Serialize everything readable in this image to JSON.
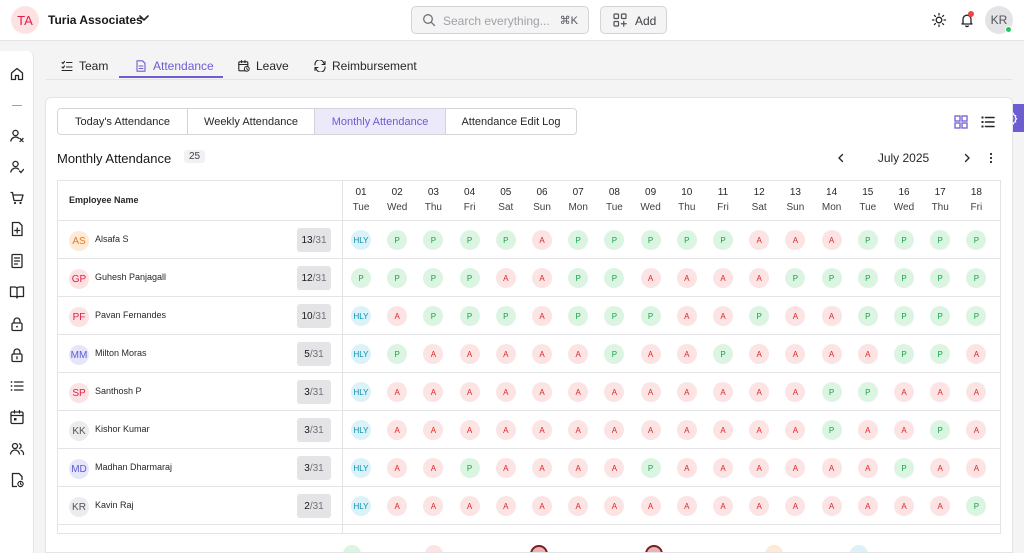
{
  "header": {
    "org_initials": "TA",
    "org_name": "Turia Associates",
    "search_placeholder": "Search everything...",
    "search_shortcut": "⌘K",
    "add_label": "Add",
    "user_initials": "KR"
  },
  "sidebar": {
    "icons": [
      "home-icon",
      "user-x-icon",
      "user-check-icon",
      "cart-icon",
      "file-plus-icon",
      "receipt-icon",
      "book-open-icon",
      "lock-icon",
      "lock-open-icon",
      "list-icon",
      "calendar-icon",
      "users-icon",
      "file-clock-icon"
    ]
  },
  "main_tabs": [
    {
      "label": "Team",
      "icon": "list-checks-icon",
      "active": false
    },
    {
      "label": "Attendance",
      "icon": "file-text-icon",
      "active": true
    },
    {
      "label": "Leave",
      "icon": "calendar-clock-icon",
      "active": false
    },
    {
      "label": "Reimbursement",
      "icon": "refresh-icon",
      "active": false
    }
  ],
  "sub_tabs": [
    {
      "label": "Today's Attendance",
      "active": false
    },
    {
      "label": "Weekly Attendance",
      "active": false
    },
    {
      "label": "Monthly Attendance",
      "active": true
    },
    {
      "label": "Attendance Edit Log",
      "active": false
    }
  ],
  "section": {
    "title": "Monthly Attendance",
    "count": "25",
    "month": "July 2025"
  },
  "table": {
    "name_header": "Employee Name",
    "days": [
      {
        "num": "01",
        "dow": "Tue"
      },
      {
        "num": "02",
        "dow": "Wed"
      },
      {
        "num": "03",
        "dow": "Thu"
      },
      {
        "num": "04",
        "dow": "Fri"
      },
      {
        "num": "05",
        "dow": "Sat"
      },
      {
        "num": "06",
        "dow": "Sun"
      },
      {
        "num": "07",
        "dow": "Mon"
      },
      {
        "num": "08",
        "dow": "Tue"
      },
      {
        "num": "09",
        "dow": "Wed"
      },
      {
        "num": "10",
        "dow": "Thu"
      },
      {
        "num": "11",
        "dow": "Fri"
      },
      {
        "num": "12",
        "dow": "Sat"
      },
      {
        "num": "13",
        "dow": "Sun"
      },
      {
        "num": "14",
        "dow": "Mon"
      },
      {
        "num": "15",
        "dow": "Tue"
      },
      {
        "num": "16",
        "dow": "Wed"
      },
      {
        "num": "17",
        "dow": "Thu"
      },
      {
        "num": "18",
        "dow": "Fri"
      }
    ],
    "rows": [
      {
        "initials": "AS",
        "name": "Alsafa S",
        "present": "13",
        "total": "/31",
        "avatar_bg": "#feead6",
        "avatar_fg": "#ea7a1e",
        "statuses": [
          "HLY",
          "P",
          "P",
          "P",
          "P",
          "A",
          "P",
          "P",
          "P",
          "P",
          "P",
          "A",
          "A",
          "A",
          "P",
          "P",
          "P",
          "P"
        ]
      },
      {
        "initials": "GP",
        "name": "Guhesh Panjagall",
        "present": "12",
        "total": "/31",
        "avatar_bg": "#fde2e4",
        "avatar_fg": "#e11d48",
        "statuses": [
          "P",
          "P",
          "P",
          "P",
          "A",
          "A",
          "P",
          "P",
          "A",
          "A",
          "A",
          "A",
          "P",
          "P",
          "P",
          "P",
          "P",
          "P"
        ]
      },
      {
        "initials": "PF",
        "name": "Pavan Fernandes",
        "present": "10",
        "total": "/31",
        "avatar_bg": "#fde2e4",
        "avatar_fg": "#e11d48",
        "statuses": [
          "HLY",
          "A",
          "P",
          "P",
          "P",
          "A",
          "P",
          "P",
          "P",
          "A",
          "A",
          "P",
          "A",
          "A",
          "P",
          "P",
          "P",
          "P"
        ]
      },
      {
        "initials": "MM",
        "name": "Milton Moras",
        "present": "5",
        "total": "/31",
        "avatar_bg": "#e6e6fb",
        "avatar_fg": "#5b5bd6",
        "statuses": [
          "HLY",
          "P",
          "A",
          "A",
          "A",
          "A",
          "A",
          "P",
          "A",
          "A",
          "P",
          "A",
          "A",
          "A",
          "A",
          "P",
          "P",
          "A"
        ]
      },
      {
        "initials": "SP",
        "name": "Santhosh P",
        "present": "3",
        "total": "/31",
        "avatar_bg": "#fde2e4",
        "avatar_fg": "#e11d48",
        "statuses": [
          "HLY",
          "A",
          "A",
          "A",
          "A",
          "A",
          "A",
          "A",
          "A",
          "A",
          "A",
          "A",
          "A",
          "P",
          "P",
          "A",
          "A",
          "A"
        ]
      },
      {
        "initials": "KK",
        "name": "Kishor Kumar",
        "present": "3",
        "total": "/31",
        "avatar_bg": "#ececee",
        "avatar_fg": "#52525b",
        "statuses": [
          "HLY",
          "A",
          "A",
          "A",
          "A",
          "A",
          "A",
          "A",
          "A",
          "A",
          "A",
          "A",
          "A",
          "P",
          "A",
          "A",
          "P",
          "A"
        ]
      },
      {
        "initials": "MD",
        "name": "Madhan Dharmaraj",
        "present": "3",
        "total": "/31",
        "avatar_bg": "#e6e6fb",
        "avatar_fg": "#5b5bd6",
        "statuses": [
          "HLY",
          "A",
          "A",
          "P",
          "A",
          "A",
          "A",
          "A",
          "P",
          "A",
          "A",
          "A",
          "A",
          "A",
          "A",
          "P",
          "A",
          "A"
        ]
      },
      {
        "initials": "KR",
        "name": "Kavin Raj",
        "present": "2",
        "total": "/31",
        "avatar_bg": "#ececee",
        "avatar_fg": "#52525b",
        "statuses": [
          "HLY",
          "A",
          "A",
          "A",
          "A",
          "A",
          "A",
          "A",
          "A",
          "A",
          "A",
          "A",
          "A",
          "A",
          "A",
          "A",
          "A",
          "P"
        ]
      }
    ]
  },
  "colors": {
    "accent": "#6d5dd3",
    "present_bg": "#dcf5e3",
    "absent_bg": "#fde4e4",
    "holiday_bg": "#dbf2f8"
  }
}
